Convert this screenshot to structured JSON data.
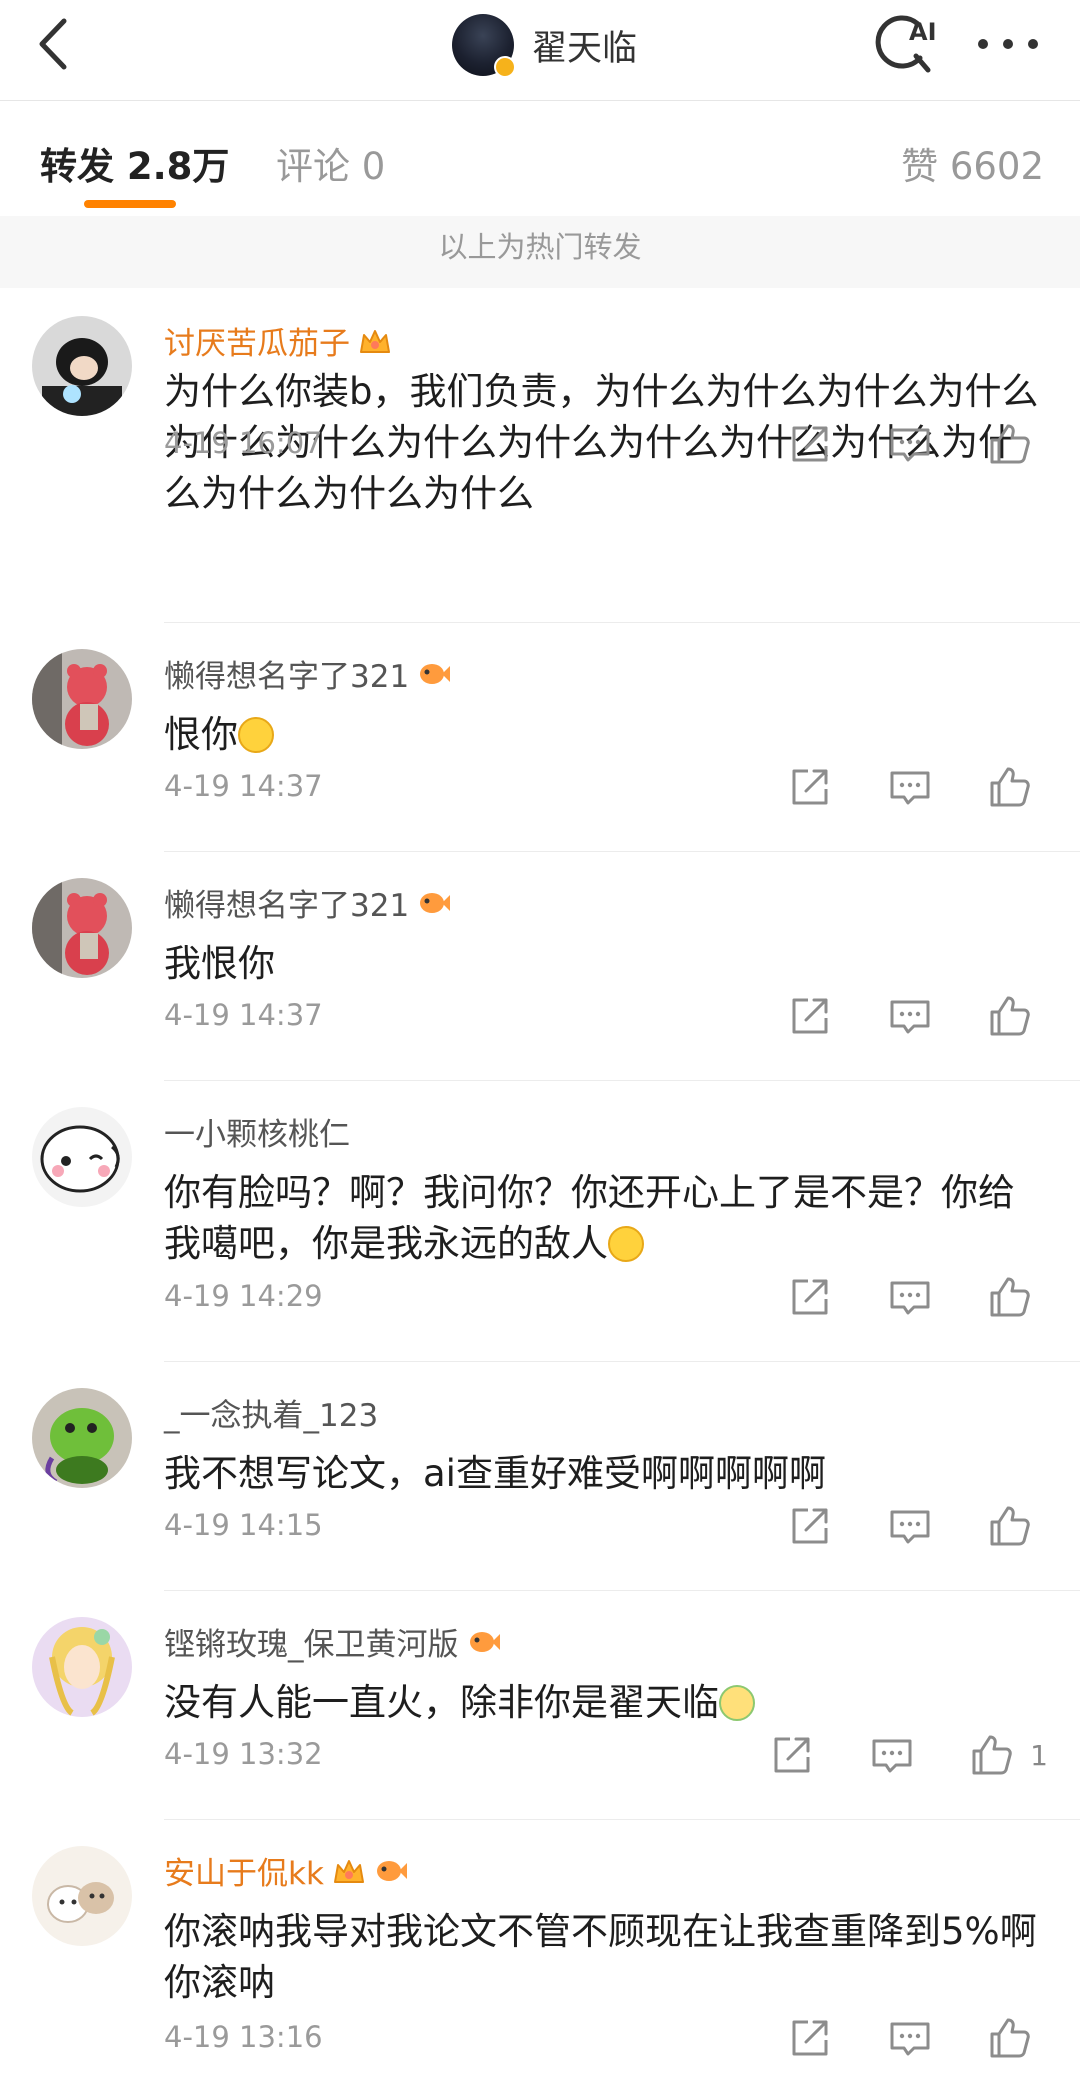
{
  "nav": {
    "title": "翟天临",
    "ai_label": "AI"
  },
  "tabs": {
    "repost": "转发 2.8万",
    "comment": "评论 0",
    "like": "赞 6602"
  },
  "section_header": "以上为热门转发",
  "colors": {
    "accent": "#ff8200",
    "username_vip": "#e77b1c",
    "username_normal": "#555555",
    "meta_gray": "#9a9a9a"
  },
  "comments": [
    {
      "username": "讨厌苦瓜茄子",
      "text": "为什么你装b，我们负责，为什么为什么为什么为什么为什么为什么为什么为什么为什么为什么为什么为什么为什么为什么为什么",
      "time": "4-19 16:07",
      "likes": "",
      "badges": [
        "crown-icon"
      ]
    },
    {
      "username": "懒得想名字了321",
      "text": "恨你",
      "time": "4-19 14:37",
      "likes": "",
      "badges": [
        "fish-icon"
      ]
    },
    {
      "username": "懒得想名字了321",
      "text": "我恨你",
      "time": "4-19 14:37",
      "likes": "",
      "badges": [
        "fish-icon"
      ]
    },
    {
      "username": "一小颗核桃仁",
      "text": "你有脸吗？啊？我问你？你还开心上了是不是？你给我噶吧，你是我永远的敌人",
      "time": "4-19 14:29",
      "likes": "",
      "badges": []
    },
    {
      "username": "_一念执着_123",
      "text": "我不想写论文，ai查重好难受啊啊啊啊啊",
      "time": "4-19 14:15",
      "likes": "",
      "badges": []
    },
    {
      "username": "铿锵玫瑰_保卫黄河版",
      "text": "没有人能一直火，除非你是翟天临",
      "time": "4-19 13:32",
      "likes": "1",
      "badges": [
        "fish-icon"
      ]
    },
    {
      "username": "安山于侃kk",
      "text": "你滚呐我导对我论文不管不顾现在让我查重降到5%啊你滚呐",
      "time": "4-19 13:16",
      "likes": "",
      "badges": [
        "crown-icon",
        "fish-icon"
      ]
    }
  ]
}
